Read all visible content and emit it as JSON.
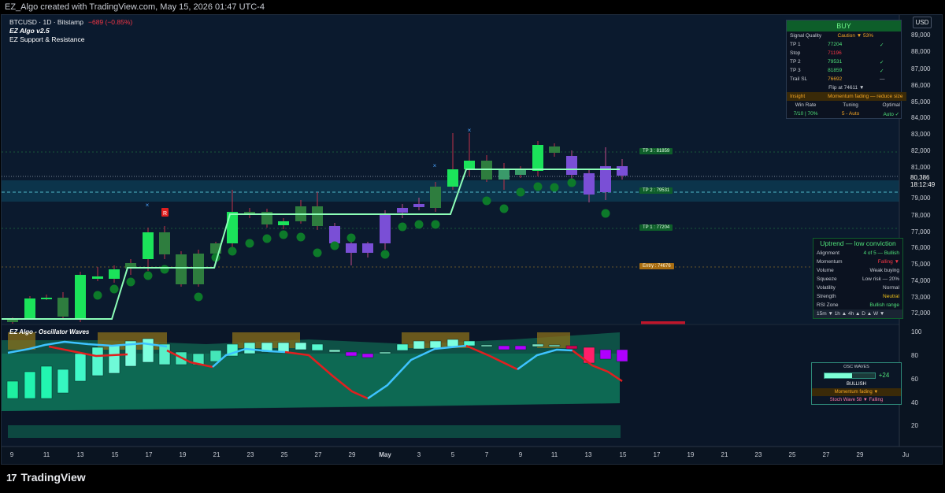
{
  "header": {
    "caption": "EZ_Algo created with TradingView.com, May 15, 2026 01:47 UTC-4"
  },
  "legend": {
    "symbol": "BTCUSD · 1D · Bitstamp",
    "change": "−689 (−0.85%)",
    "indicator_1": "EZ Algo v2.5",
    "indicator_2": "EZ Support & Resistance"
  },
  "price_axis": {
    "currency": "USD",
    "labels": [
      "89,000",
      "88,000",
      "87,000",
      "86,000",
      "85,000",
      "84,000",
      "83,000",
      "82,000",
      "81,000",
      "79,000",
      "78,000",
      "77,000",
      "76,000",
      "75,000",
      "74,000",
      "73,000",
      "72,000"
    ],
    "current_price": "80,386",
    "countdown": "18:12:49"
  },
  "signal_panel": {
    "title": "BUY",
    "rows": [
      {
        "label": "Signal Quality",
        "value": "Caution ▼ 53%",
        "check": ""
      },
      {
        "label": "TP 1",
        "value": "77204",
        "check": "✓"
      },
      {
        "label": "Stop",
        "value": "71196",
        "check": ""
      },
      {
        "label": "TP 2",
        "value": "79531",
        "check": "✓"
      },
      {
        "label": "TP 3",
        "value": "81859",
        "check": "✓"
      },
      {
        "label": "Trail SL",
        "value": "76692",
        "check": "—"
      }
    ],
    "flip": "Flip at  74611 ▼",
    "insight_label": "Insight",
    "insight_value": "Momentum fading — reduce size",
    "footer_headers": [
      "Win Rate",
      "Tuning",
      "Optimal"
    ],
    "footer_values": [
      "7/10 | 70%",
      "5 - Auto",
      "Auto ✓"
    ]
  },
  "level_tags": {
    "tp3": "TP 3 : 81859",
    "tp2": "TP 2 : 79531",
    "tp1": "TP 1 : 77204",
    "entry": "Entry : 74676"
  },
  "trend_panel": {
    "title": "Uptrend — low conviction",
    "rows": [
      {
        "label": "Alignment",
        "value": "4 of 5 — Bullish"
      },
      {
        "label": "Momentum",
        "value": "Falling ▼"
      },
      {
        "label": "Volume",
        "value": "Weak buying"
      },
      {
        "label": "Squeeze",
        "value": "Low risk — 20%"
      },
      {
        "label": "Volatility",
        "value": "Normal"
      },
      {
        "label": "Strength",
        "value": "Neutral"
      },
      {
        "label": "RSI Zone",
        "value": "Bullish range"
      }
    ],
    "timeframes": "15m ▼  1h ▲  4h ▲      D ▲  W ▼"
  },
  "oscillator": {
    "title": "EZ Algo - Oscillator Waves",
    "axis_labels": [
      "100",
      "80",
      "60",
      "40",
      "20"
    ],
    "panel_title": "OSC WAVES",
    "score": "+24",
    "state": "BULLISH",
    "momentum": "Momentum fading ▼",
    "stoch": "Stoch Wave  58  ▼  Falling"
  },
  "markers": {
    "reversal": "R"
  },
  "time_axis": [
    "9",
    "11",
    "13",
    "15",
    "17",
    "19",
    "21",
    "23",
    "25",
    "27",
    "29",
    "May",
    "3",
    "5",
    "7",
    "9",
    "11",
    "13",
    "15",
    "17",
    "19",
    "21",
    "23",
    "25",
    "27",
    "29",
    "Ju"
  ],
  "footer": {
    "brand": "TradingView",
    "logo": "17"
  },
  "colors": {
    "bull": "#1be35a",
    "bear": "#7a4fd6",
    "accent": "#00e7ff",
    "up_line": "#7dffb3",
    "down_line": "#e11f1f"
  }
}
